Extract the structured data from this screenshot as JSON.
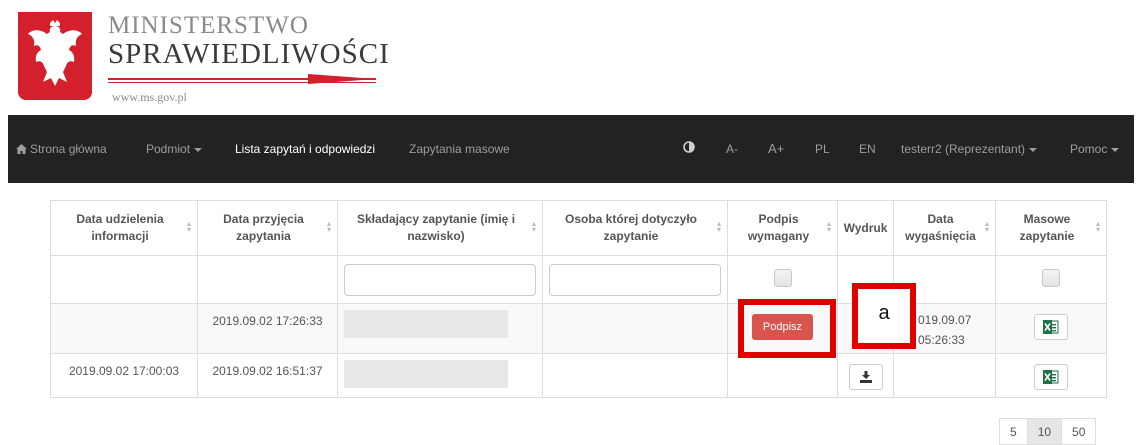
{
  "logo": {
    "line1": "MINISTERSTWO",
    "line2": "SPRAWIEDLIWOŚCI",
    "url": "www.ms.gov.pl",
    "emblem_color": "#d4202c"
  },
  "navbar": {
    "home": "Strona główna",
    "podmiot": "Podmiot",
    "lista": "Lista zapytań i odpowiedzi",
    "masowe": "Zapytania masowe",
    "font_small": "A-",
    "font_large": "A+",
    "lang_pl": "PL",
    "lang_en": "EN",
    "user": "testerr2 (Reprezentant)",
    "help": "Pomoc",
    "background": "#222222"
  },
  "table": {
    "headers": [
      "Data udzielenia informacji",
      "Data przyjęcia zapytania",
      "Składający zapytanie (imię i nazwisko)",
      "Osoba której dotyczyło zapytanie",
      "Podpis wymagany",
      "Wydruk",
      "Data wygaśnięcia",
      "Masowe zapytanie"
    ],
    "rows": [
      {
        "data_udzielenia": "",
        "data_przyjecia": "2019.09.02 17:26:33",
        "podpis_button": "Podpisz",
        "data_wygasniecia_1": "019.09.07",
        "data_wygasniecia_2": "05:26:33"
      },
      {
        "data_udzielenia": "2019.09.02 17:00:03",
        "data_przyjecia": "2019.09.02 16:51:37"
      }
    ]
  },
  "annotation": {
    "label": "a",
    "color": "#e00000"
  },
  "pagination": {
    "options": [
      "5",
      "10",
      "50"
    ],
    "selected": "10"
  }
}
